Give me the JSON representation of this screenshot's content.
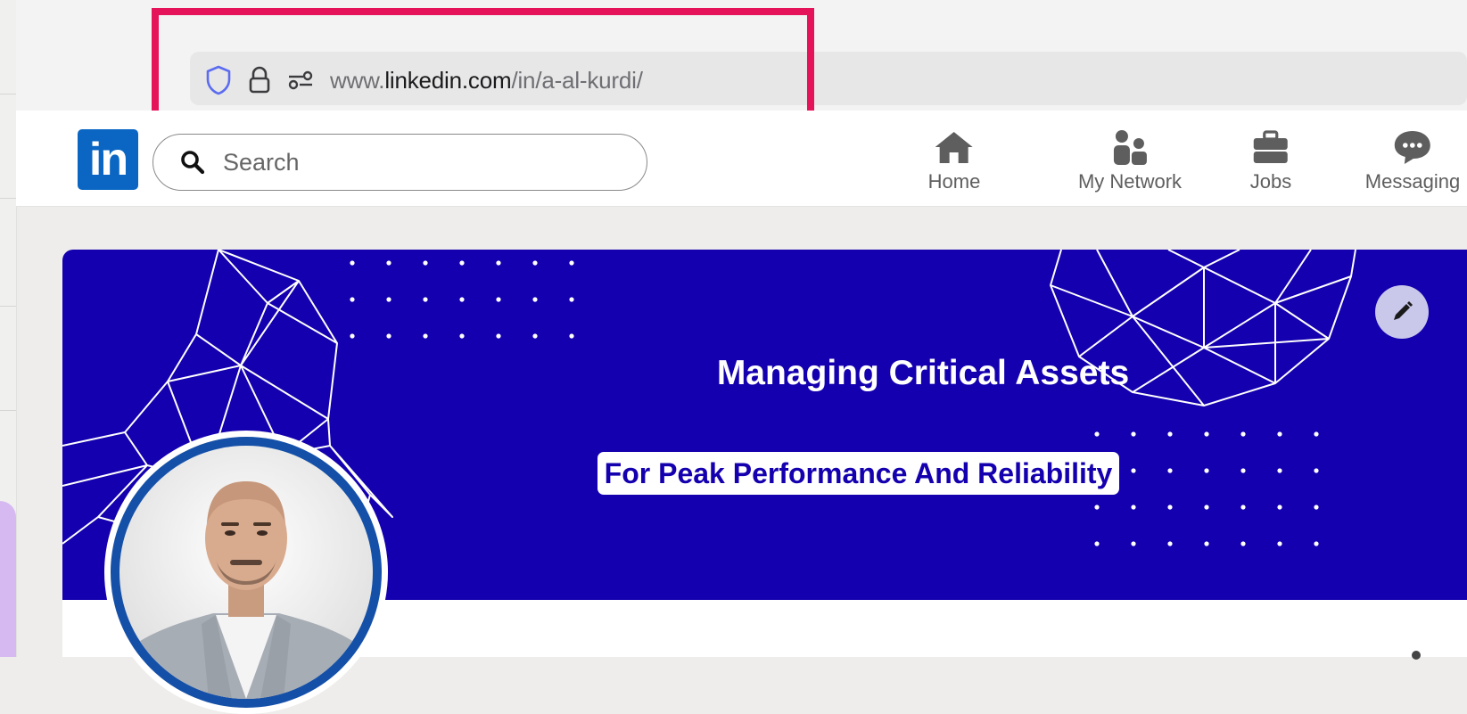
{
  "browser": {
    "url_prefix": "www.",
    "url_domain": "linkedin.com",
    "url_path": "/in/a-al-kurdi/"
  },
  "linkedin": {
    "logo_text": "in",
    "search_placeholder": "Search",
    "nav": [
      {
        "label": "Home",
        "icon": "home-icon"
      },
      {
        "label": "My Network",
        "icon": "network-icon"
      },
      {
        "label": "Jobs",
        "icon": "briefcase-icon"
      },
      {
        "label": "Messaging",
        "icon": "messaging-icon"
      }
    ]
  },
  "banner": {
    "title": "Managing Critical Assets",
    "subtitle": "For Peak Performance And Reliability",
    "background_color": "#1400ae"
  },
  "colors": {
    "highlight": "#e5145a",
    "linkedin_blue": "#0a66c2"
  }
}
